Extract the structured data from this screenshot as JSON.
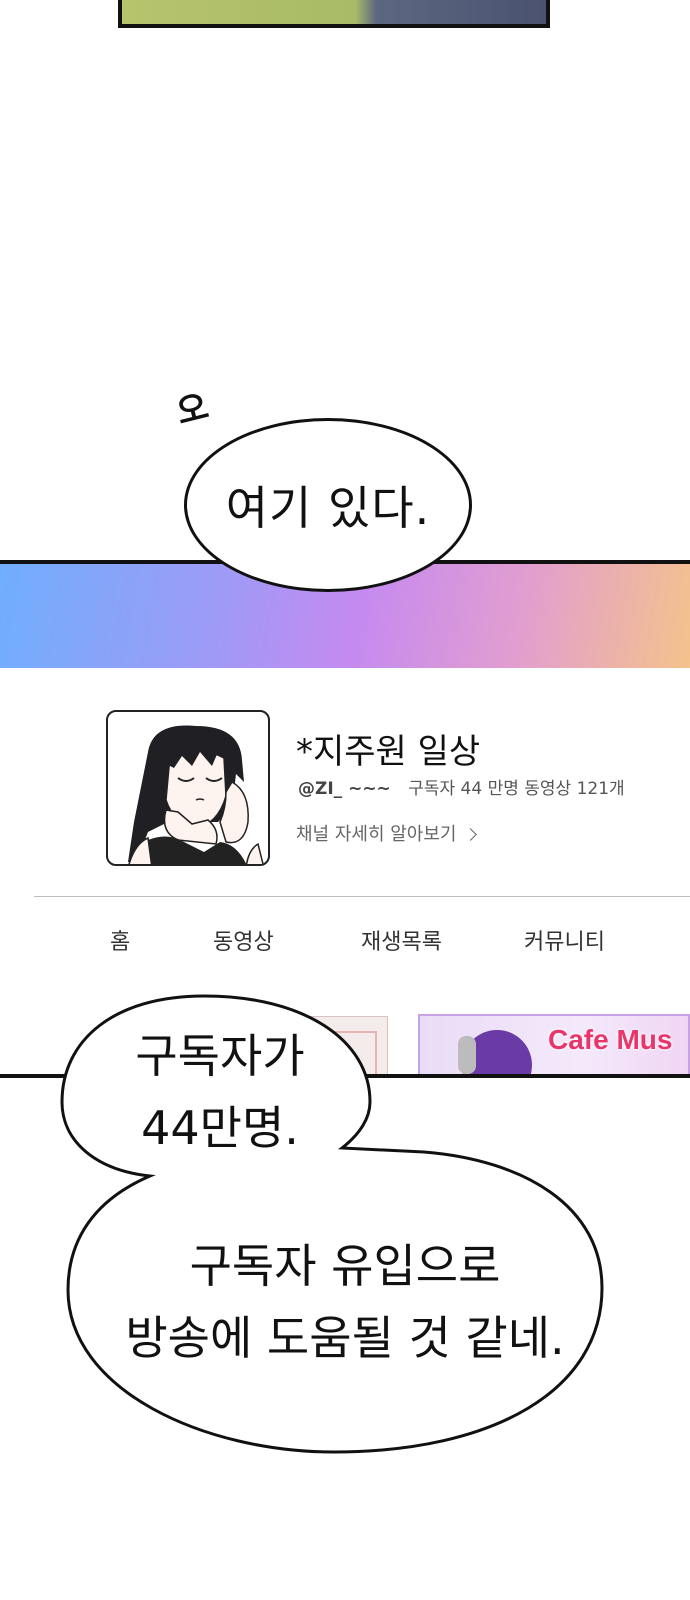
{
  "sfx": "오",
  "bubble_1": "여기 있다.",
  "channel": {
    "name": "*지주원 일상",
    "handle": "@ZI_ ~~~",
    "stats": "구독자 44 만명 동영상 121개",
    "more_link": "채널 자세히 알아보기",
    "more_icon": "chevron-right-icon"
  },
  "tabs": [
    "홈",
    "동영상",
    "재생목록",
    "커뮤니티"
  ],
  "thumbnail_2_text": "Cafe Mus",
  "bubble_2": {
    "line1": "구독자가",
    "line2": "44만명.",
    "line3": "구독자 유입으로",
    "line4": "방송에 도움될 것 같네."
  },
  "colors": {
    "banner_gradient": [
      "#70aefc",
      "#c58af0",
      "#f4c28c"
    ],
    "outline": "#111111"
  }
}
